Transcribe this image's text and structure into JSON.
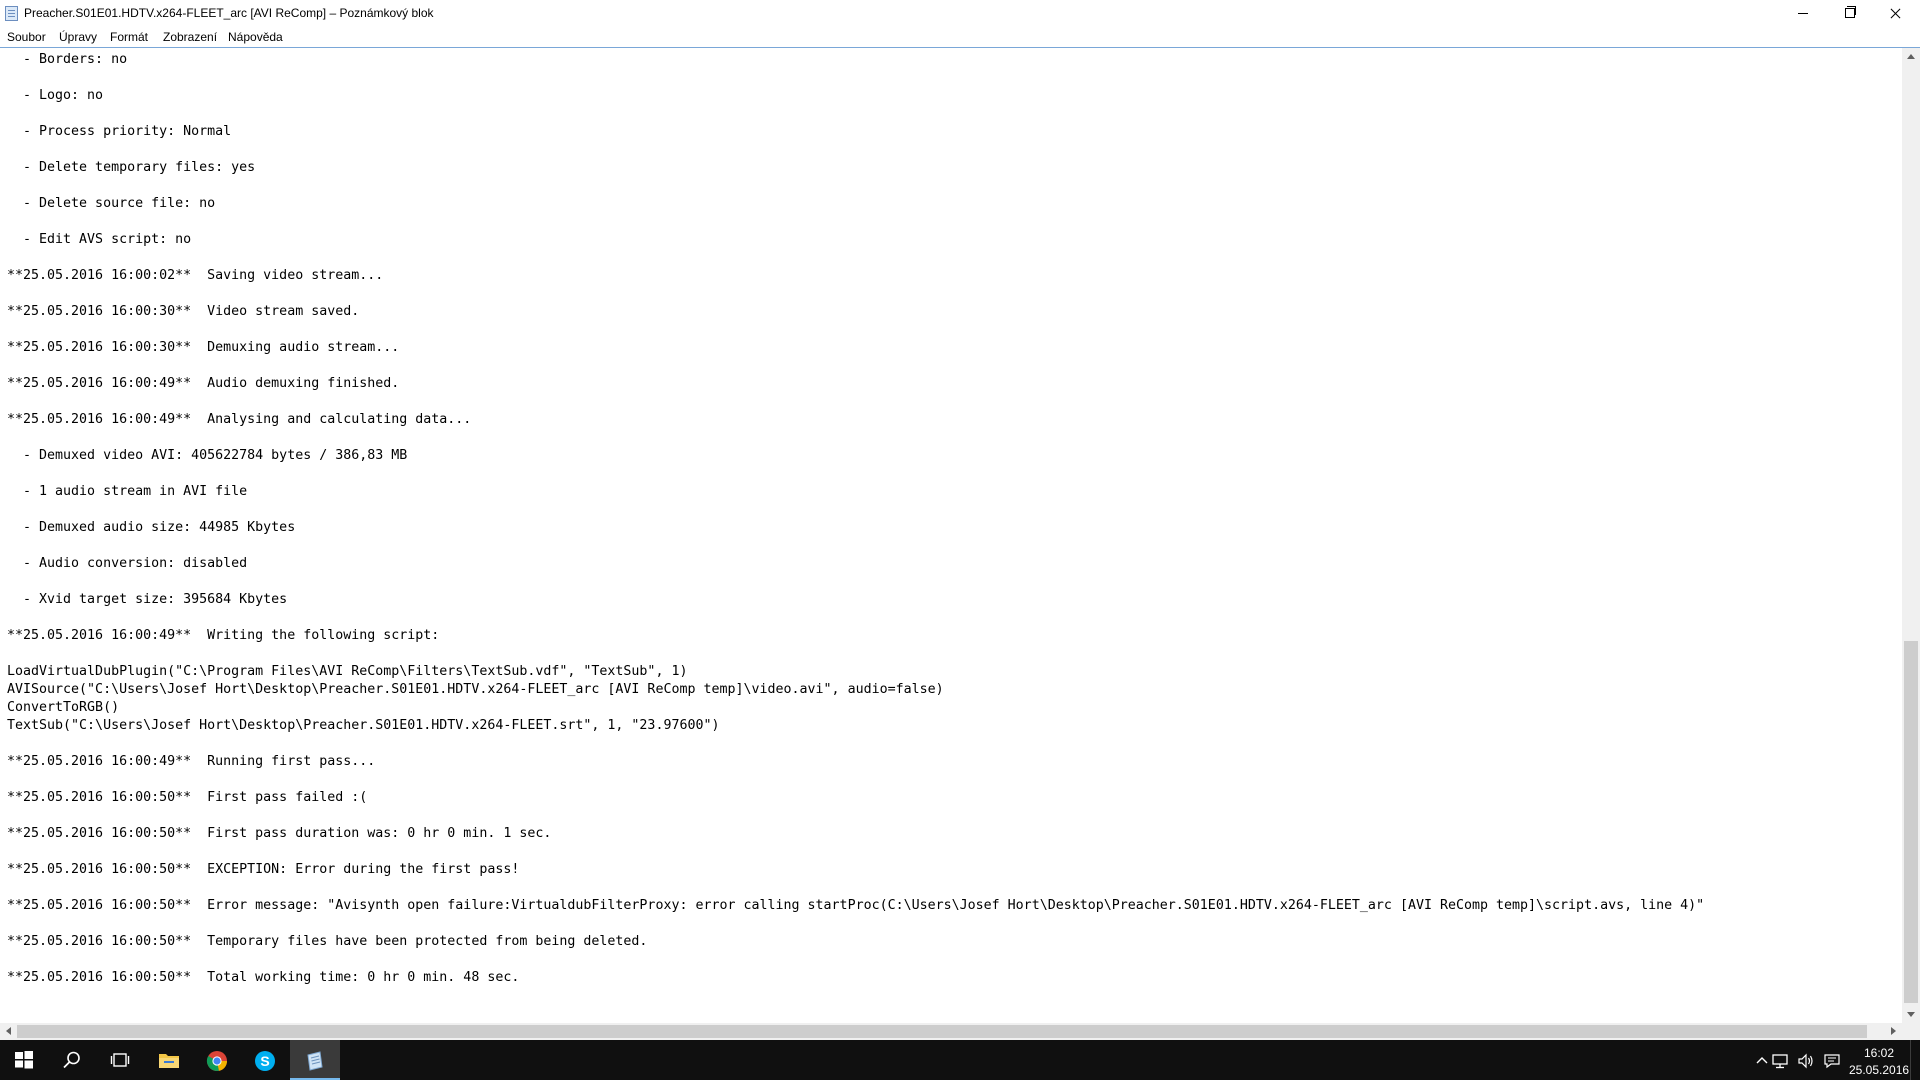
{
  "window": {
    "title": "Preacher.S01E01.HDTV.x264-FLEET_arc [AVI ReComp] – Poznámkový blok"
  },
  "menu": {
    "items": [
      {
        "label": "Soubor"
      },
      {
        "label": "Úpravy"
      },
      {
        "label": "Formát"
      },
      {
        "label": "Zobrazení"
      },
      {
        "label": "Nápověda"
      }
    ]
  },
  "document": {
    "lines": [
      "  - Borders: no",
      "",
      "  - Logo: no",
      "",
      "  - Process priority: Normal",
      "",
      "  - Delete temporary files: yes",
      "",
      "  - Delete source file: no",
      "",
      "  - Edit AVS script: no",
      "",
      "**25.05.2016 16:00:02**  Saving video stream...",
      "",
      "**25.05.2016 16:00:30**  Video stream saved.",
      "",
      "**25.05.2016 16:00:30**  Demuxing audio stream...",
      "",
      "**25.05.2016 16:00:49**  Audio demuxing finished.",
      "",
      "**25.05.2016 16:00:49**  Analysing and calculating data...",
      "",
      "  - Demuxed video AVI: 405622784 bytes / 386,83 MB",
      "",
      "  - 1 audio stream in AVI file",
      "",
      "  - Demuxed audio size: 44985 Kbytes",
      "",
      "  - Audio conversion: disabled",
      "",
      "  - Xvid target size: 395684 Kbytes",
      "",
      "**25.05.2016 16:00:49**  Writing the following script:",
      "",
      "LoadVirtualDubPlugin(\"C:\\Program Files\\AVI ReComp\\Filters\\TextSub.vdf\", \"TextSub\", 1)",
      "AVISource(\"C:\\Users\\Josef Hort\\Desktop\\Preacher.S01E01.HDTV.x264-FLEET_arc [AVI ReComp temp]\\video.avi\", audio=false)",
      "ConvertToRGB()",
      "TextSub(\"C:\\Users\\Josef Hort\\Desktop\\Preacher.S01E01.HDTV.x264-FLEET.srt\", 1, \"23.97600\")",
      "",
      "**25.05.2016 16:00:49**  Running first pass...",
      "",
      "**25.05.2016 16:00:50**  First pass failed :(",
      "",
      "**25.05.2016 16:00:50**  First pass duration was: 0 hr 0 min. 1 sec.",
      "",
      "**25.05.2016 16:00:50**  EXCEPTION: Error during the first pass!",
      "",
      "**25.05.2016 16:00:50**  Error message: \"Avisynth open failure:VirtualdubFilterProxy: error calling startProc(C:\\Users\\Josef Hort\\Desktop\\Preacher.S01E01.HDTV.x264-FLEET_arc [AVI ReComp temp]\\script.avs, line 4)\"",
      "",
      "**25.05.2016 16:00:50**  Temporary files have been protected from being deleted.",
      "",
      "**25.05.2016 16:00:50**  Total working time: 0 hr 0 min. 48 sec."
    ]
  },
  "taskbar": {
    "pinned": [
      {
        "icon": "windows-start-icon"
      },
      {
        "icon": "search-icon"
      },
      {
        "icon": "task-view-icon"
      },
      {
        "icon": "file-explorer-icon"
      },
      {
        "icon": "chrome-icon"
      },
      {
        "icon": "skype-icon"
      },
      {
        "icon": "notepad-icon",
        "active": true
      }
    ],
    "clock": {
      "time": "16:02",
      "date": "25.05.2016"
    }
  },
  "colors": {
    "accent": "#76b9ed",
    "taskbar": "#101010"
  }
}
